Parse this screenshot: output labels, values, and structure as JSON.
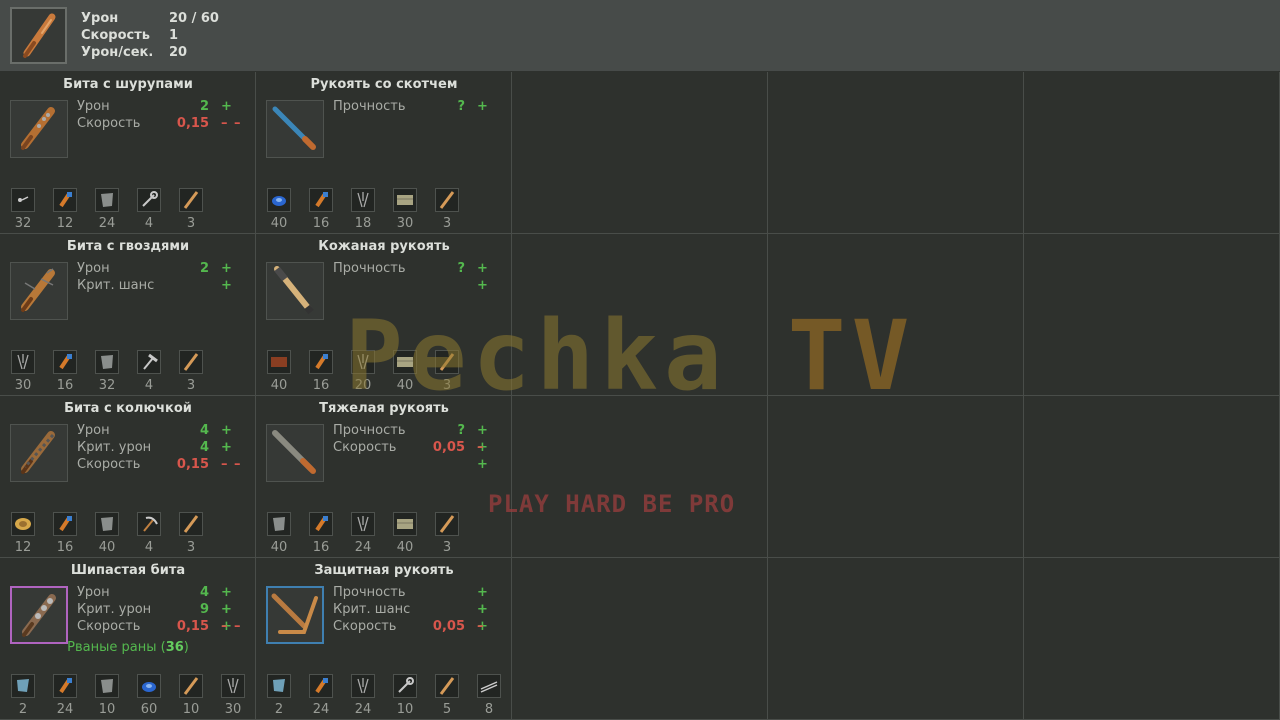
{
  "header": {
    "stats": [
      {
        "label": "Урон",
        "value": "20 / 60"
      },
      {
        "label": "Скорость",
        "value": "1"
      },
      {
        "label": "Урон/сек.",
        "value": "20"
      }
    ]
  },
  "cells": [
    {
      "row": 0,
      "col": 0,
      "title": "Бита с шурупами",
      "icon": "screw-bat-icon",
      "frame": "",
      "stats": [
        {
          "label": "Урон",
          "value": "2",
          "value_color": "green",
          "mark": "+",
          "mark_color": "green"
        },
        {
          "label": "Скорость",
          "value": "0,15",
          "value_color": "red",
          "mark": "– –",
          "mark_color": "red"
        }
      ],
      "special": null,
      "materials": [
        {
          "icon": "screws-icon",
          "count": "32"
        },
        {
          "icon": "tape-icon",
          "count": "12"
        },
        {
          "icon": "metal-plate-icon",
          "count": "24"
        },
        {
          "icon": "wrench-icon",
          "count": "4"
        },
        {
          "icon": "stick-icon",
          "count": "3"
        }
      ]
    },
    {
      "row": 0,
      "col": 1,
      "title": "Рукоять со скотчем",
      "icon": "taped-handle-icon",
      "frame": "",
      "stats": [
        {
          "label": "Прочность",
          "value": "?",
          "value_color": "green",
          "mark": "+",
          "mark_color": "green"
        }
      ],
      "special": null,
      "materials": [
        {
          "icon": "blue-tape-icon",
          "count": "40"
        },
        {
          "icon": "tape-icon",
          "count": "16"
        },
        {
          "icon": "nails-icon",
          "count": "18"
        },
        {
          "icon": "cloth-icon",
          "count": "30"
        },
        {
          "icon": "stick-icon",
          "count": "3"
        }
      ]
    },
    {
      "row": 1,
      "col": 0,
      "title": "Бита с гвоздями",
      "icon": "nail-bat-icon",
      "frame": "",
      "stats": [
        {
          "label": "Урон",
          "value": "2",
          "value_color": "green",
          "mark": "+",
          "mark_color": "green"
        },
        {
          "label": "Крит. шанс",
          "value": "",
          "value_color": "green",
          "mark": "+",
          "mark_color": "green"
        }
      ],
      "special": null,
      "materials": [
        {
          "icon": "nails-icon",
          "count": "30"
        },
        {
          "icon": "tape-icon",
          "count": "16"
        },
        {
          "icon": "metal-plate-icon",
          "count": "32"
        },
        {
          "icon": "hammer-icon",
          "count": "4"
        },
        {
          "icon": "stick-icon",
          "count": "3"
        }
      ]
    },
    {
      "row": 1,
      "col": 1,
      "title": "Кожаная рукоять",
      "icon": "leather-handle-icon",
      "frame": "",
      "stats": [
        {
          "label": "Прочность",
          "value": "?",
          "value_color": "green",
          "mark": "+ +",
          "mark_color": "green"
        }
      ],
      "special": null,
      "materials": [
        {
          "icon": "leather-icon",
          "count": "40"
        },
        {
          "icon": "tape-icon",
          "count": "16"
        },
        {
          "icon": "nails-icon",
          "count": "20"
        },
        {
          "icon": "cloth-icon",
          "count": "40"
        },
        {
          "icon": "stick-icon",
          "count": "3"
        }
      ]
    },
    {
      "row": 2,
      "col": 0,
      "title": "Бита с колючкой",
      "icon": "barbed-bat-icon",
      "frame": "",
      "stats": [
        {
          "label": "Урон",
          "value": "4",
          "value_color": "green",
          "mark": "+ +",
          "mark_color": "green"
        },
        {
          "label": "Крит. урон",
          "value": "4",
          "value_color": "green",
          "mark": "+",
          "mark_color": "green"
        },
        {
          "label": "Скорость",
          "value": "0,15",
          "value_color": "red",
          "mark": "– –",
          "mark_color": "red"
        }
      ],
      "special": null,
      "materials": [
        {
          "icon": "wire-coil-icon",
          "count": "12"
        },
        {
          "icon": "tape-icon",
          "count": "16"
        },
        {
          "icon": "metal-plate-icon",
          "count": "40"
        },
        {
          "icon": "pickaxe-icon",
          "count": "4"
        },
        {
          "icon": "stick-icon",
          "count": "3"
        }
      ]
    },
    {
      "row": 2,
      "col": 1,
      "title": "Тяжелая рукоять",
      "icon": "heavy-handle-icon",
      "frame": "",
      "stats": [
        {
          "label": "Прочность",
          "value": "?",
          "value_color": "green",
          "mark": "+ + +",
          "mark_color": "green"
        },
        {
          "label": "Скорость",
          "value": "0,05",
          "value_color": "red",
          "mark": "–",
          "mark_color": "red"
        }
      ],
      "special": null,
      "materials": [
        {
          "icon": "metal-plate-icon",
          "count": "40"
        },
        {
          "icon": "tape-icon",
          "count": "16"
        },
        {
          "icon": "nails-icon",
          "count": "24"
        },
        {
          "icon": "cloth-icon",
          "count": "40"
        },
        {
          "icon": "stick-icon",
          "count": "3"
        }
      ]
    },
    {
      "row": 3,
      "col": 0,
      "title": "Шипастая бита",
      "icon": "spiked-bat-icon",
      "frame": "rare",
      "stats": [
        {
          "label": "Урон",
          "value": "4",
          "value_color": "green",
          "mark": "+ +",
          "mark_color": "green"
        },
        {
          "label": "Крит. урон",
          "value": "9",
          "value_color": "green",
          "mark": "+ +",
          "mark_color": "green"
        },
        {
          "label": "Скорость",
          "value": "0,15",
          "value_color": "red",
          "mark": "– –",
          "mark_color": "red"
        }
      ],
      "special": {
        "label": "Рваные раны",
        "value": "36"
      },
      "materials": [
        {
          "icon": "metal-shard-icon",
          "count": "2"
        },
        {
          "icon": "tape-icon",
          "count": "24"
        },
        {
          "icon": "metal-plate-icon",
          "count": "10"
        },
        {
          "icon": "blue-tape-icon",
          "count": "60"
        },
        {
          "icon": "stick-icon",
          "count": "10"
        },
        {
          "icon": "nails-icon",
          "count": "30"
        }
      ]
    },
    {
      "row": 3,
      "col": 1,
      "title": "Защитная рукоять",
      "icon": "guard-handle-icon",
      "frame": "blue",
      "stats": [
        {
          "label": "Прочность",
          "value": "",
          "value_color": "green",
          "mark": "+ + +",
          "mark_color": "green"
        },
        {
          "label": "Крит. шанс",
          "value": "",
          "value_color": "green",
          "mark": "+",
          "mark_color": "green"
        },
        {
          "label": "Скорость",
          "value": "0,05",
          "value_color": "red",
          "mark": "–",
          "mark_color": "red"
        }
      ],
      "special": null,
      "materials": [
        {
          "icon": "metal-shard-icon",
          "count": "2"
        },
        {
          "icon": "tape-icon",
          "count": "24"
        },
        {
          "icon": "nails-icon",
          "count": "24"
        },
        {
          "icon": "wrench-icon",
          "count": "10"
        },
        {
          "icon": "stick-icon",
          "count": "5"
        },
        {
          "icon": "rods-icon",
          "count": "8"
        }
      ]
    }
  ],
  "watermark": {
    "title": "Pechka",
    "title_suffix": "TV",
    "tagline": "PLAY HARD  BE PRO"
  }
}
